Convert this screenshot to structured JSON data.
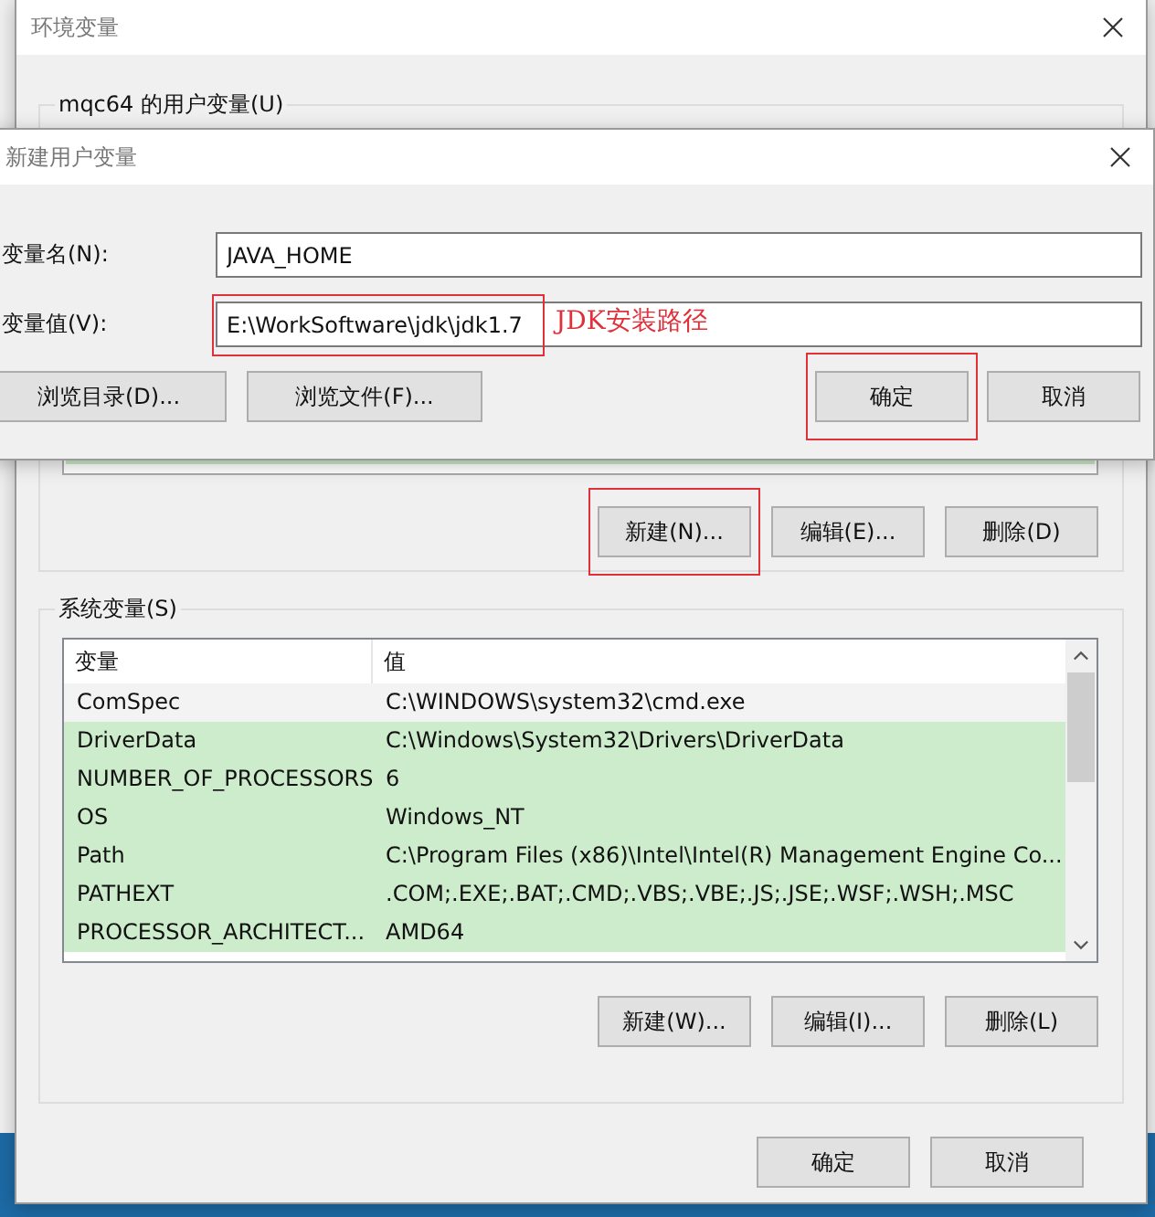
{
  "env_dialog": {
    "title": "环境变量",
    "user_section": {
      "label": "mqc64 的用户变量(U)",
      "buttons": [
        {
          "label": "新建(N)...",
          "annotated": true
        },
        {
          "label": "编辑(E)...",
          "annotated": false
        },
        {
          "label": "删除(D)",
          "annotated": false
        }
      ]
    },
    "system_section": {
      "label": "系统变量(S)",
      "columns": [
        "变量",
        "值"
      ],
      "rows": [
        {
          "name": "ComSpec",
          "value": "C:\\WINDOWS\\system32\\cmd.exe",
          "highlighted": false
        },
        {
          "name": "DriverData",
          "value": "C:\\Windows\\System32\\Drivers\\DriverData",
          "highlighted": true
        },
        {
          "name": "NUMBER_OF_PROCESSORS",
          "value": "6",
          "highlighted": true
        },
        {
          "name": "OS",
          "value": "Windows_NT",
          "highlighted": true
        },
        {
          "name": "Path",
          "value": "C:\\Program Files (x86)\\Intel\\Intel(R) Management Engine Co...",
          "highlighted": true
        },
        {
          "name": "PATHEXT",
          "value": ".COM;.EXE;.BAT;.CMD;.VBS;.VBE;.JS;.JSE;.WSF;.WSH;.MSC",
          "highlighted": true
        },
        {
          "name": "PROCESSOR_ARCHITECT...",
          "value": "AMD64",
          "highlighted": true
        }
      ],
      "buttons": [
        {
          "label": "新建(W)..."
        },
        {
          "label": "编辑(I)..."
        },
        {
          "label": "删除(L)"
        }
      ]
    },
    "buttons": [
      {
        "label": "确定"
      },
      {
        "label": "取消"
      }
    ]
  },
  "new_var_dialog": {
    "title": "新建用户变量",
    "fields": [
      {
        "label": "变量名(N):",
        "value": "JAVA_HOME",
        "annotated": false
      },
      {
        "label": "变量值(V):",
        "value": "E:\\WorkSoftware\\jdk\\jdk1.7",
        "annotated": true
      }
    ],
    "annotation": "JDK安装路径",
    "left_buttons": [
      {
        "label": "浏览目录(D)..."
      },
      {
        "label": "浏览文件(F)..."
      }
    ],
    "right_buttons": [
      {
        "label": "确定",
        "annotated": true
      },
      {
        "label": "取消",
        "annotated": false
      }
    ]
  }
}
